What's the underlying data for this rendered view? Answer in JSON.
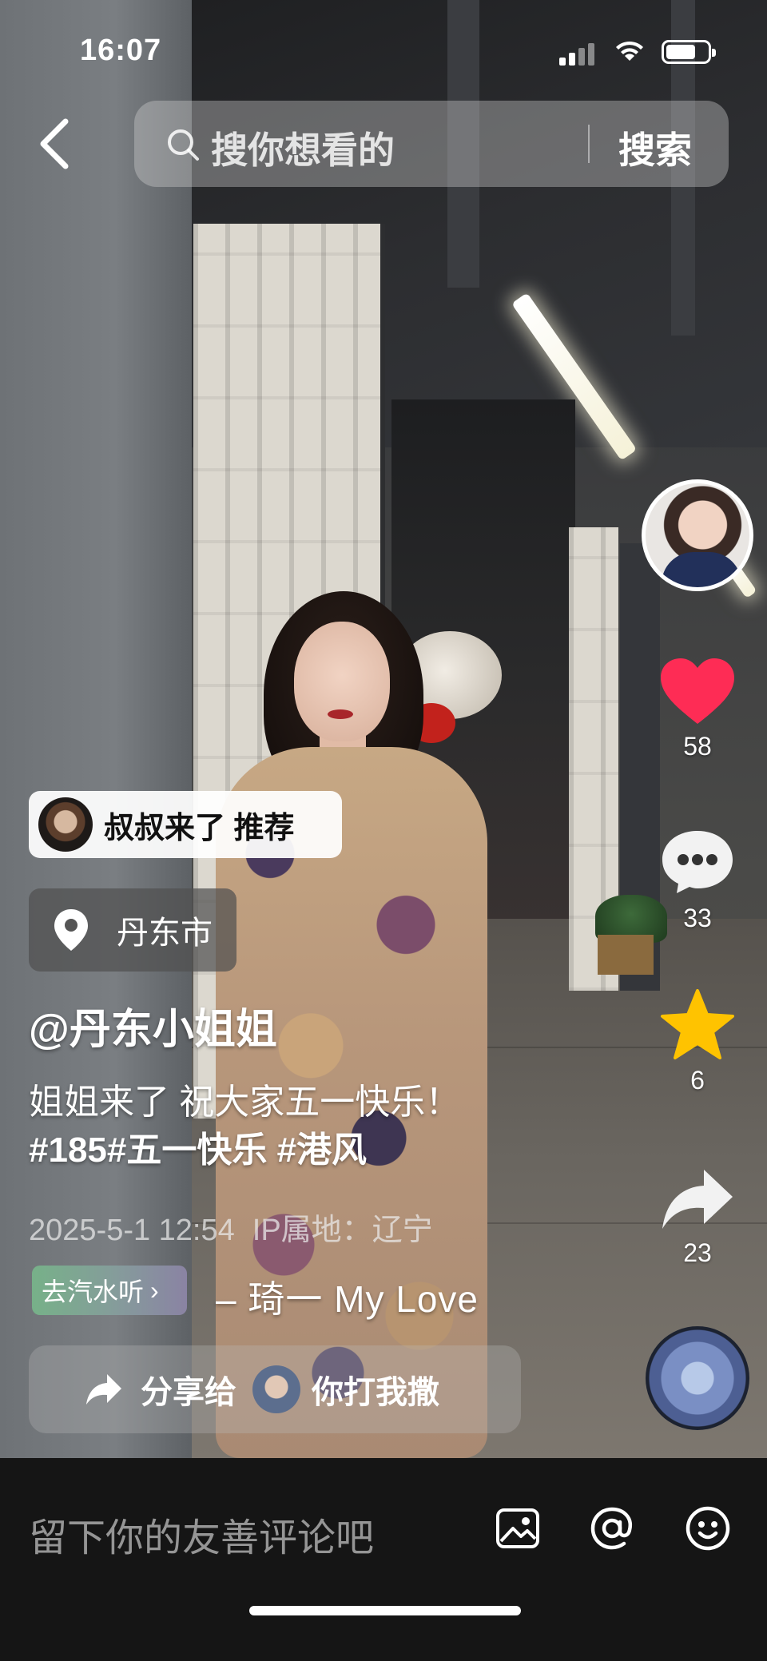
{
  "status_bar": {
    "time": "16:07"
  },
  "search": {
    "placeholder": "搜你想看的",
    "button_label": "搜索"
  },
  "recommend": {
    "label": "叔叔来了 推荐"
  },
  "location": {
    "city": "丹东市"
  },
  "post": {
    "author": "@丹东小姐姐",
    "caption": "姐姐来了 祝大家五一快乐！",
    "hashtags": "#185#五一快乐 #港风",
    "date": "2025-5-1 12:54",
    "ip": "IP属地：辽宁"
  },
  "music": {
    "soda_label": "去汽水听",
    "title": "– 琦一   My Love"
  },
  "share": {
    "label": "分享给",
    "friend_name": "你打我撒"
  },
  "rail": {
    "likes": "58",
    "comments": "33",
    "favorites": "6",
    "shares": "23"
  },
  "comment_bar": {
    "placeholder": "留下你的友善评论吧"
  },
  "colors": {
    "like": "#FE2C55",
    "favorite": "#FFC300"
  }
}
